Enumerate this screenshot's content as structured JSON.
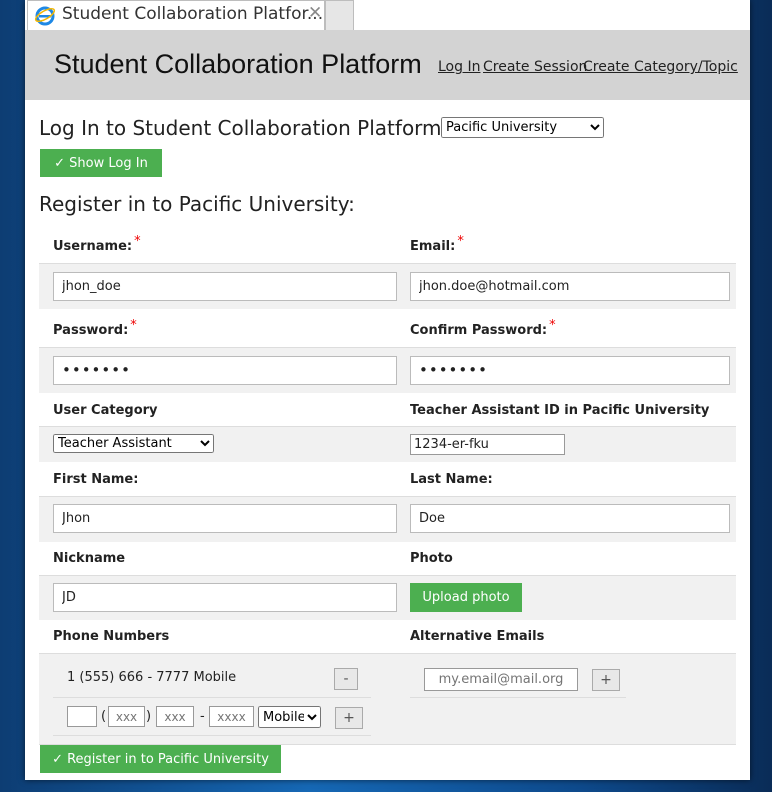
{
  "browser": {
    "tab_title": "Student Collaboration Platfor...",
    "close_glyph": "✕"
  },
  "header": {
    "title": "Student Collaboration Platform",
    "nav": {
      "login": "Log In",
      "create_session": "Create Session",
      "create_category": "Create Category/Topic"
    }
  },
  "login_section": {
    "heading": "Log In to Student Collaboration Platform of",
    "university_selected": "Pacific University",
    "show_login_label": "✓ Show Log In"
  },
  "register": {
    "heading": "Register in to Pacific University:",
    "required_mark": "*",
    "username": {
      "label": "Username:",
      "value": "jhon_doe"
    },
    "email": {
      "label": "Email:",
      "value": "jhon.doe@hotmail.com"
    },
    "password": {
      "label": "Password:",
      "value": "•••••••"
    },
    "confirm_password": {
      "label": "Confirm Password:",
      "value": "•••••••"
    },
    "user_category": {
      "label": "User Category",
      "selected": "Teacher Assistant"
    },
    "ta_id": {
      "label": "Teacher Assistant ID in Pacific University",
      "value": "1234-er-fku"
    },
    "first_name": {
      "label": "First Name:",
      "value": "Jhon"
    },
    "last_name": {
      "label": "Last Name:",
      "value": "Doe"
    },
    "nickname": {
      "label": "Nickname",
      "value": "JD"
    },
    "photo": {
      "label": "Photo",
      "button": "Upload photo"
    },
    "phones": {
      "label": "Phone Numbers",
      "existing": "1 (555) 666 - 7777 Mobile",
      "remove_glyph": "-",
      "add_glyph": "+",
      "open_paren": "(",
      "close_paren": ")",
      "dash": "-",
      "area_placeholder": "xxx",
      "prefix_placeholder": "xxx",
      "line_placeholder": "xxxx",
      "type_selected": "Mobile"
    },
    "alt_emails": {
      "label": "Alternative Emails",
      "placeholder": "my.email@mail.org",
      "add_glyph": "+"
    },
    "submit_label": "✓ Register in to Pacific University"
  },
  "colors": {
    "accent_green": "#4caf50",
    "header_gray": "#d3d3d3",
    "required_red": "#ee0000"
  }
}
